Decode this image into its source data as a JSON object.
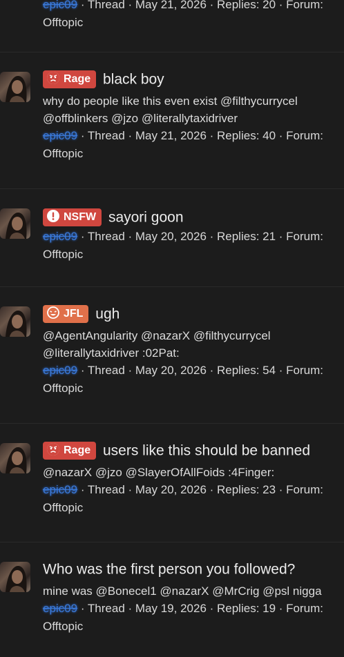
{
  "threads": [
    {
      "title": "",
      "snippet": "",
      "author": "epic09",
      "meta": " · Thread · May 21, 2026 · Replies: 20 · Forum:",
      "forum": "Offtopic"
    },
    {
      "badge": "Rage",
      "title": "black boy",
      "snippet": "why do people like this even exist @filthycurrycel @offblinkers @jzo @literallytaxidriver",
      "author": "epic09",
      "meta": " · Thread · May 21, 2026 · Replies: 40 · Forum:",
      "forum": "Offtopic"
    },
    {
      "badge": "NSFW",
      "title": "sayori goon",
      "snippet": "",
      "author": "epic09",
      "meta": " · Thread · May 20, 2026 · Replies: 21 · Forum:",
      "forum": "Offtopic"
    },
    {
      "badge": "JFL",
      "title": "ugh",
      "snippet": "@AgentAngularity @nazarX @filthycurrycel @literallytaxidriver :02Pat:",
      "author": "epic09",
      "meta": " · Thread · May 20, 2026 · Replies: 54 · Forum:",
      "forum": "Offtopic"
    },
    {
      "badge": "Rage",
      "title": "users like this should be banned",
      "snippet": "@nazarX @jzo @SlayerOfAllFoids :4Finger:",
      "author": "epic09",
      "meta": " · Thread · May 20, 2026 · Replies: 23 · Forum:",
      "forum": "Offtopic"
    },
    {
      "badge": "",
      "title": "Who was the first person you followed?",
      "snippet": "mine was @Bonecel1 @nazarX @MrCrig @psl nigga",
      "author": "epic09",
      "meta": " · Thread · May 19, 2026 · Replies: 19 · Forum:",
      "forum": "Offtopic"
    }
  ],
  "colors": {
    "background": "#1c1c1c",
    "rage_badge": "#d0473f",
    "nsfw_badge": "#d0473f",
    "jfl_badge": "#e0704a",
    "author_link": "#3b7ad9"
  },
  "icons": {
    "rage": "angry-face-icon",
    "nsfw": "exclamation-icon",
    "jfl": "laughing-face-icon"
  }
}
